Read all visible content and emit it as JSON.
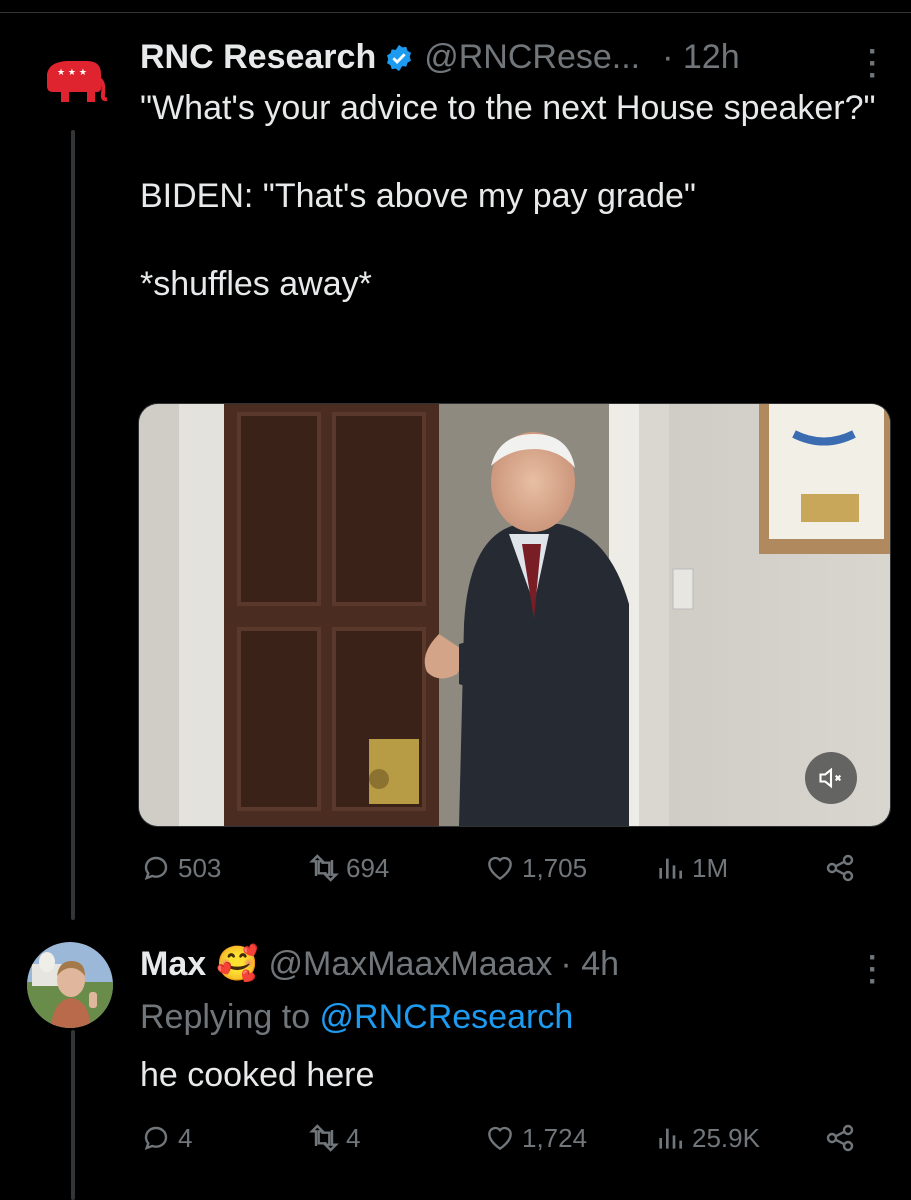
{
  "tweet": {
    "author_name": "RNC Research",
    "handle": "@RNCRese...",
    "time": "· 12h",
    "text": "\"What's your advice to the next House speaker?\"\n\nBIDEN: \"That's above my pay grade\"\n\n*shuffles away*",
    "stats": {
      "replies": "503",
      "retweets": "694",
      "likes": "1,705",
      "views": "1M"
    }
  },
  "reply": {
    "author_name": "Max",
    "emoji": "🥰",
    "handle": "@MaxMaaxMaaax",
    "time": "· 4h",
    "replying_prefix": "Replying to ",
    "replying_handle": "@RNCResearch",
    "text": "he cooked here",
    "stats": {
      "replies": "4",
      "retweets": "4",
      "likes": "1,724",
      "views": "25.9K"
    }
  },
  "icons": {
    "verified": "verified-badge-icon",
    "more": "more-icon",
    "reply": "reply-icon",
    "retweet": "retweet-icon",
    "like": "heart-icon",
    "views": "views-icon",
    "share": "share-icon",
    "mute": "mute-icon"
  },
  "colors": {
    "background": "#000000",
    "text": "#e7e9ea",
    "muted": "#71767b",
    "link": "#1d9bf0",
    "rnc_red": "#e0242f"
  }
}
